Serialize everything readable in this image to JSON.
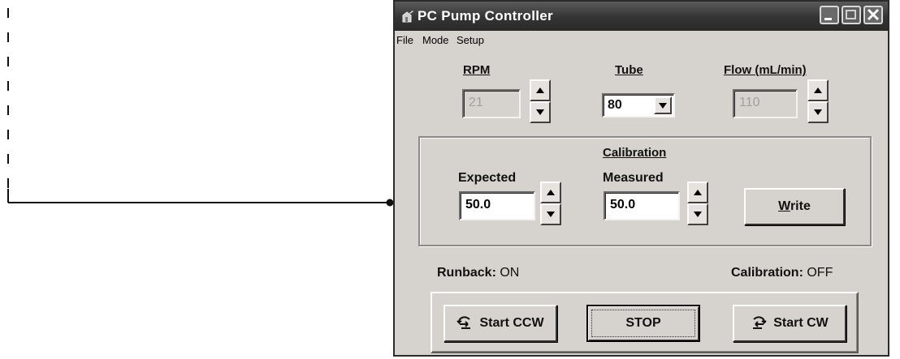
{
  "window": {
    "title": "PC Pump Controller"
  },
  "menu": {
    "items": [
      "File",
      "Mode",
      "Setup"
    ]
  },
  "top_fields": {
    "rpm": {
      "label": "RPM",
      "value": "21"
    },
    "tube": {
      "label": "Tube",
      "value": "80"
    },
    "flow": {
      "label": "Flow (mL/min)",
      "value": "110"
    }
  },
  "calibration": {
    "group_label": "Calibration",
    "expected": {
      "label": "Expected",
      "value": "50.0"
    },
    "measured": {
      "label": "Measured",
      "value": "50.0"
    },
    "write_button": {
      "accel": "W",
      "rest": "rite"
    }
  },
  "status": {
    "runback_label": "Runback:",
    "runback_value": "ON",
    "calibration_label": "Calibration:",
    "calibration_value": "OFF"
  },
  "controls": {
    "start_ccw": "Start CCW",
    "stop": "STOP",
    "start_cw": "Start CW"
  }
}
